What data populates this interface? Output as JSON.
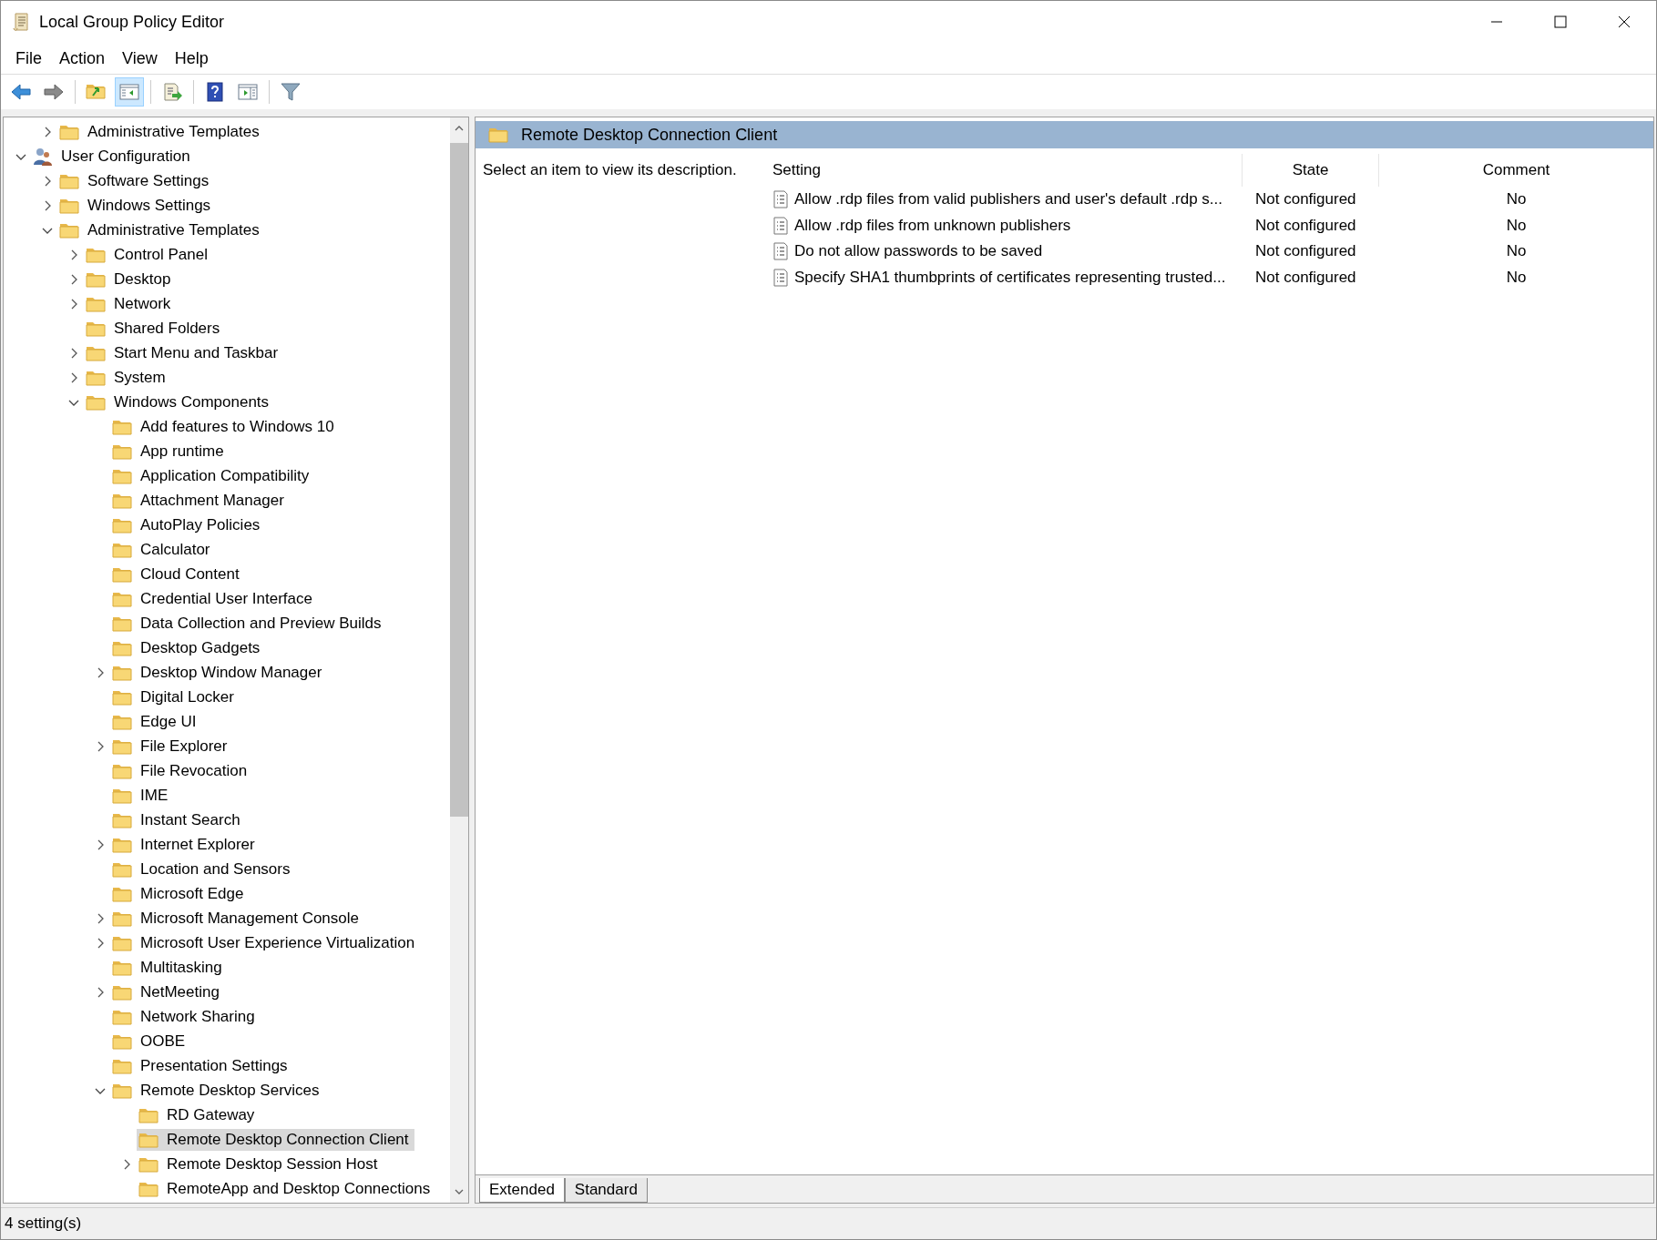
{
  "window": {
    "title": "Local Group Policy Editor"
  },
  "menu": [
    {
      "label": "File"
    },
    {
      "label": "Action"
    },
    {
      "label": "View"
    },
    {
      "label": "Help"
    }
  ],
  "toolbar": [
    {
      "kind": "back",
      "selected": false
    },
    {
      "kind": "forward",
      "selected": false
    },
    {
      "kind": "up",
      "selected": false
    },
    {
      "kind": "tree",
      "selected": true
    },
    {
      "kind": "export",
      "selected": false
    },
    {
      "kind": "help",
      "selected": false
    },
    {
      "kind": "pane",
      "selected": false
    },
    {
      "kind": "filter",
      "selected": false
    }
  ],
  "tree": {
    "continued_items": [
      {
        "label": "Administrative Templates",
        "kind": "folder",
        "expanded": false,
        "selected": false
      }
    ],
    "items": [
      {
        "label": "User Configuration",
        "kind": "user",
        "expanded": true,
        "selected": false,
        "children": [
          {
            "label": "Software Settings",
            "kind": "folder",
            "expanded": false,
            "selected": false
          },
          {
            "label": "Windows Settings",
            "kind": "folder",
            "expanded": false,
            "selected": false
          },
          {
            "label": "Administrative Templates",
            "kind": "folder",
            "expanded": true,
            "selected": false,
            "children": [
              {
                "label": "Control Panel",
                "kind": "folder",
                "expanded": false,
                "selected": false
              },
              {
                "label": "Desktop",
                "kind": "folder",
                "expanded": false,
                "selected": false
              },
              {
                "label": "Network",
                "kind": "folder",
                "expanded": false,
                "selected": false
              },
              {
                "label": "Shared Folders",
                "kind": "folder",
                "selected": false
              },
              {
                "label": "Start Menu and Taskbar",
                "kind": "folder",
                "expanded": false,
                "selected": false
              },
              {
                "label": "System",
                "kind": "folder",
                "expanded": false,
                "selected": false
              },
              {
                "label": "Windows Components",
                "kind": "folder",
                "expanded": true,
                "selected": false,
                "children": [
                  {
                    "label": "Add features to Windows 10",
                    "kind": "folder",
                    "selected": false
                  },
                  {
                    "label": "App runtime",
                    "kind": "folder",
                    "selected": false
                  },
                  {
                    "label": "Application Compatibility",
                    "kind": "folder",
                    "selected": false
                  },
                  {
                    "label": "Attachment Manager",
                    "kind": "folder",
                    "selected": false
                  },
                  {
                    "label": "AutoPlay Policies",
                    "kind": "folder",
                    "selected": false
                  },
                  {
                    "label": "Calculator",
                    "kind": "folder",
                    "selected": false
                  },
                  {
                    "label": "Cloud Content",
                    "kind": "folder",
                    "selected": false
                  },
                  {
                    "label": "Credential User Interface",
                    "kind": "folder",
                    "selected": false
                  },
                  {
                    "label": "Data Collection and Preview Builds",
                    "kind": "folder",
                    "selected": false
                  },
                  {
                    "label": "Desktop Gadgets",
                    "kind": "folder",
                    "selected": false
                  },
                  {
                    "label": "Desktop Window Manager",
                    "kind": "folder",
                    "expanded": false,
                    "selected": false
                  },
                  {
                    "label": "Digital Locker",
                    "kind": "folder",
                    "selected": false
                  },
                  {
                    "label": "Edge UI",
                    "kind": "folder",
                    "selected": false
                  },
                  {
                    "label": "File Explorer",
                    "kind": "folder",
                    "expanded": false,
                    "selected": false
                  },
                  {
                    "label": "File Revocation",
                    "kind": "folder",
                    "selected": false
                  },
                  {
                    "label": "IME",
                    "kind": "folder",
                    "selected": false
                  },
                  {
                    "label": "Instant Search",
                    "kind": "folder",
                    "selected": false
                  },
                  {
                    "label": "Internet Explorer",
                    "kind": "folder",
                    "expanded": false,
                    "selected": false
                  },
                  {
                    "label": "Location and Sensors",
                    "kind": "folder",
                    "selected": false
                  },
                  {
                    "label": "Microsoft Edge",
                    "kind": "folder",
                    "selected": false
                  },
                  {
                    "label": "Microsoft Management Console",
                    "kind": "folder",
                    "expanded": false,
                    "selected": false
                  },
                  {
                    "label": "Microsoft User Experience Virtualization",
                    "kind": "folder",
                    "expanded": false,
                    "selected": false
                  },
                  {
                    "label": "Multitasking",
                    "kind": "folder",
                    "selected": false
                  },
                  {
                    "label": "NetMeeting",
                    "kind": "folder",
                    "expanded": false,
                    "selected": false
                  },
                  {
                    "label": "Network Sharing",
                    "kind": "folder",
                    "selected": false
                  },
                  {
                    "label": "OOBE",
                    "kind": "folder",
                    "selected": false
                  },
                  {
                    "label": "Presentation Settings",
                    "kind": "folder",
                    "selected": false
                  },
                  {
                    "label": "Remote Desktop Services",
                    "kind": "folder",
                    "expanded": true,
                    "selected": false,
                    "children": [
                      {
                        "label": "RD Gateway",
                        "kind": "folder",
                        "selected": false
                      },
                      {
                        "label": "Remote Desktop Connection Client",
                        "kind": "folder",
                        "selected": true
                      },
                      {
                        "label": "Remote Desktop Session Host",
                        "kind": "folder",
                        "expanded": false,
                        "selected": false
                      },
                      {
                        "label": "RemoteApp and Desktop Connections",
                        "kind": "folder",
                        "selected": false
                      }
                    ]
                  }
                ]
              }
            ]
          }
        ]
      }
    ]
  },
  "details": {
    "title": "Remote Desktop Connection Client",
    "description": "Select an item to view its description.",
    "table": {
      "columns": [
        "Setting",
        "State",
        "Comment"
      ],
      "rows": [
        {
          "setting": "Allow .rdp files from valid publishers and user's default .rdp s...",
          "state": "Not configured",
          "comment": "No"
        },
        {
          "setting": "Allow .rdp files from unknown publishers",
          "state": "Not configured",
          "comment": "No"
        },
        {
          "setting": "Do not allow passwords to be saved",
          "state": "Not configured",
          "comment": "No"
        },
        {
          "setting": "Specify SHA1 thumbprints of certificates representing trusted...",
          "state": "Not configured",
          "comment": "No"
        }
      ]
    },
    "tabs": [
      {
        "label": "Extended",
        "selected": true
      },
      {
        "label": "Standard",
        "selected": false
      }
    ]
  },
  "status_bar": {
    "text": "4 setting(s)"
  }
}
